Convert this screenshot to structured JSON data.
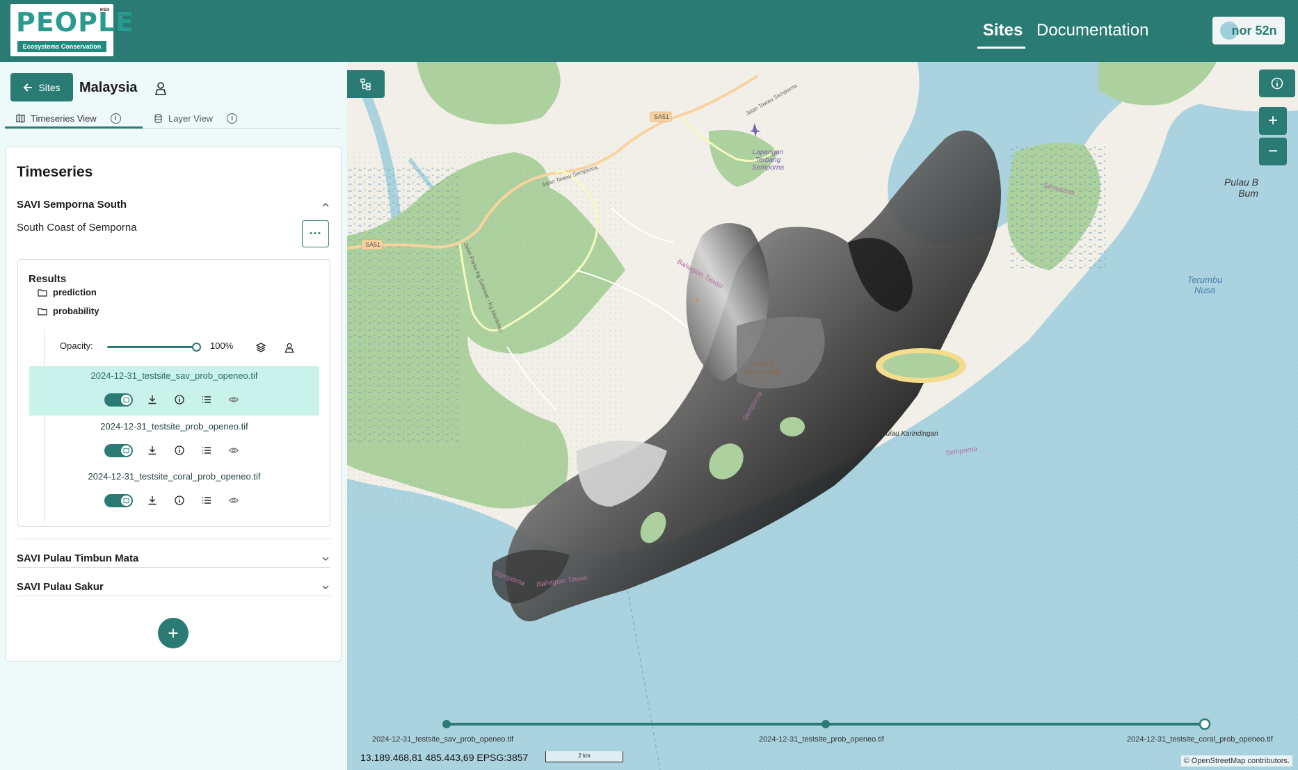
{
  "header": {
    "logo_text": "PEOPLE",
    "logo_subtitle": "Ecosystems Conservation",
    "logo_badge": "esa",
    "nav": [
      {
        "label": "Sites",
        "active": true
      },
      {
        "label": "Documentation",
        "active": false
      }
    ],
    "user_label": "nor 52n"
  },
  "sidebar": {
    "back_button_label": "Sites",
    "country": "Malaysia",
    "tabs": [
      {
        "label": "Timeseries View",
        "active": true
      },
      {
        "label": "Layer View",
        "active": false
      }
    ],
    "panel_title": "Timeseries",
    "timeseries": [
      {
        "title": "SAVI Semporna South",
        "expanded": true,
        "description": "South Coast of Semporna",
        "results_title": "Results",
        "folders": [
          "prediction",
          "probability"
        ],
        "opacity_label": "Opacity:",
        "opacity_value": "100%",
        "opacity_fraction": 1.0,
        "layers": [
          {
            "name": "2024-12-31_testsite_sav_prob_openeo.tif",
            "active": true,
            "visible": true
          },
          {
            "name": "2024-12-31_testsite_prob_openeo.tif",
            "active": false,
            "visible": true
          },
          {
            "name": "2024-12-31_testsite_coral_prob_openeo.tif",
            "active": false,
            "visible": true
          }
        ]
      },
      {
        "title": "SAVI Pulau Timbun Mata",
        "expanded": false
      },
      {
        "title": "SAVI Pulau Sakur",
        "expanded": false
      }
    ]
  },
  "map": {
    "place_labels": {
      "sa51_a": "SA51",
      "sa51_b": "SA51",
      "road_tawau_1": "Jalan Tawau Semporna",
      "road_tawau_2": "Jalan Tawau Semporna",
      "road_panta": "Jalan Panta Kg Selamat - Kg Mentelep",
      "airport": "Lapangan Terbang Semporna",
      "bahagian_1": "Bahagian Tawau",
      "bahagian_2": "Bahagian Tawau",
      "gunung": "Gunung Conner 368 m",
      "semporna_1": "Semporna",
      "semporna_2": "Semporna",
      "semporna_3": "Semporna",
      "semporna_4": "Semporna",
      "terumbu": "Terumbu Nusa",
      "pulau_karindingan": "Pulau Karindingan",
      "pulau_bum": "Pulau B Bum"
    },
    "timeline": [
      {
        "label": "2024-12-31_testsite_sav_prob_openeo.tif"
      },
      {
        "label": "2024-12-31_testsite_prob_openeo.tif"
      },
      {
        "label": "2024-12-31_testsite_coral_prob_openeo.tif"
      }
    ],
    "coordinates": "13.189.468,81 485.443,69 EPSG:3857",
    "scale_label": "2 km",
    "attribution": "© OpenStreetMap contributors."
  },
  "colors": {
    "primary": "#2a7b74",
    "active_row": "#c9f3ea",
    "sea": "#aad3df",
    "land": "#f2efe9",
    "forest": "#add19e"
  }
}
